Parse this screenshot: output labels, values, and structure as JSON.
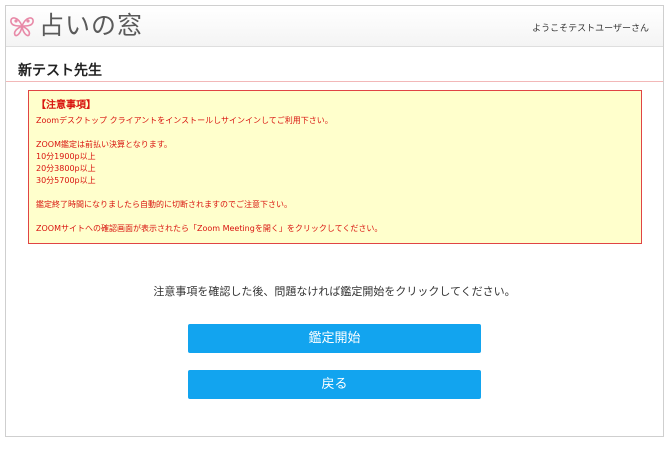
{
  "header": {
    "logo_text": "占いの窓",
    "welcome": "ようこそテストユーザーさん"
  },
  "page": {
    "title": "新テスト先生"
  },
  "notice": {
    "heading": "【注意事項】",
    "lines": [
      "Zoomデスクトップ クライアントをインストールしサインインしてご利用下さい。",
      "",
      "ZOOM鑑定は前払い決算となります。",
      "10分1900p以上",
      "20分3800p以上",
      "30分5700p以上",
      "",
      "鑑定終了時間になりましたら自動的に切断されますのでご注意下さい。",
      "",
      "ZOOMサイトへの確認画面が表示されたら「Zoom Meetingを開く」をクリックしてください。"
    ]
  },
  "instruction": "注意事項を確認した後、問題なければ鑑定開始をクリックしてください。",
  "buttons": {
    "start": "鑑定開始",
    "back": "戻る"
  },
  "colors": {
    "accent_button": "#12a4ef",
    "notice_background": "#ffffcc",
    "notice_border": "#e04444",
    "notice_text": "#d9140f",
    "logo_pink": "#e88aa8"
  }
}
